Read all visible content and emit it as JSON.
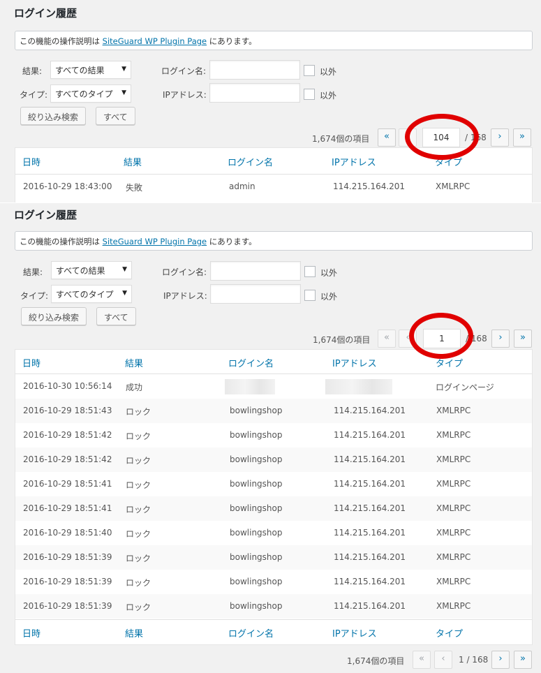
{
  "page": {
    "title": "ログイン履歴"
  },
  "notice": {
    "before": "この機能の操作説明は",
    "link": "SiteGuard WP Plugin Page",
    "after": "にあります。"
  },
  "filters": {
    "result_label": "結果:",
    "result_value": "すべての結果",
    "type_label": "タイプ:",
    "type_value": "すべてのタイプ",
    "login_label": "ログイン名:",
    "ip_label": "IPアドレス:",
    "exclude_label": "以外",
    "search_button": "絞り込み検索",
    "all_button": "すべて"
  },
  "pagination": {
    "count_text": "1,674個の項目",
    "first": "«",
    "prev": "‹",
    "next": "›",
    "last": "»",
    "total_text": "/ 168",
    "top_current_1": "104",
    "top_current_2": "1",
    "bottom_text": "1 / 168"
  },
  "columns": {
    "date": "日時",
    "result": "結果",
    "login": "ログイン名",
    "ip": "IPアドレス",
    "type": "タイプ"
  },
  "rows_panel1": [
    {
      "date": "2016-10-29 18:43:00",
      "result": "失敗",
      "login": "admin",
      "ip": "114.215.164.201",
      "type": "XMLRPC"
    }
  ],
  "rows_panel2": [
    {
      "date": "2016-10-30 10:56:14",
      "result": "成功",
      "login": "",
      "ip": "",
      "type": "ログインページ"
    },
    {
      "date": "2016-10-29 18:51:43",
      "result": "ロック",
      "login": "bowlingshop",
      "ip": "114.215.164.201",
      "type": "XMLRPC"
    },
    {
      "date": "2016-10-29 18:51:42",
      "result": "ロック",
      "login": "bowlingshop",
      "ip": "114.215.164.201",
      "type": "XMLRPC"
    },
    {
      "date": "2016-10-29 18:51:42",
      "result": "ロック",
      "login": "bowlingshop",
      "ip": "114.215.164.201",
      "type": "XMLRPC"
    },
    {
      "date": "2016-10-29 18:51:41",
      "result": "ロック",
      "login": "bowlingshop",
      "ip": "114.215.164.201",
      "type": "XMLRPC"
    },
    {
      "date": "2016-10-29 18:51:41",
      "result": "ロック",
      "login": "bowlingshop",
      "ip": "114.215.164.201",
      "type": "XMLRPC"
    },
    {
      "date": "2016-10-29 18:51:40",
      "result": "ロック",
      "login": "bowlingshop",
      "ip": "114.215.164.201",
      "type": "XMLRPC"
    },
    {
      "date": "2016-10-29 18:51:39",
      "result": "ロック",
      "login": "bowlingshop",
      "ip": "114.215.164.201",
      "type": "XMLRPC"
    },
    {
      "date": "2016-10-29 18:51:39",
      "result": "ロック",
      "login": "bowlingshop",
      "ip": "114.215.164.201",
      "type": "XMLRPC"
    },
    {
      "date": "2016-10-29 18:51:39",
      "result": "ロック",
      "login": "bowlingshop",
      "ip": "114.215.164.201",
      "type": "XMLRPC"
    }
  ],
  "colors": {
    "link": "#0073aa",
    "highlight_ring": "#e00000"
  }
}
